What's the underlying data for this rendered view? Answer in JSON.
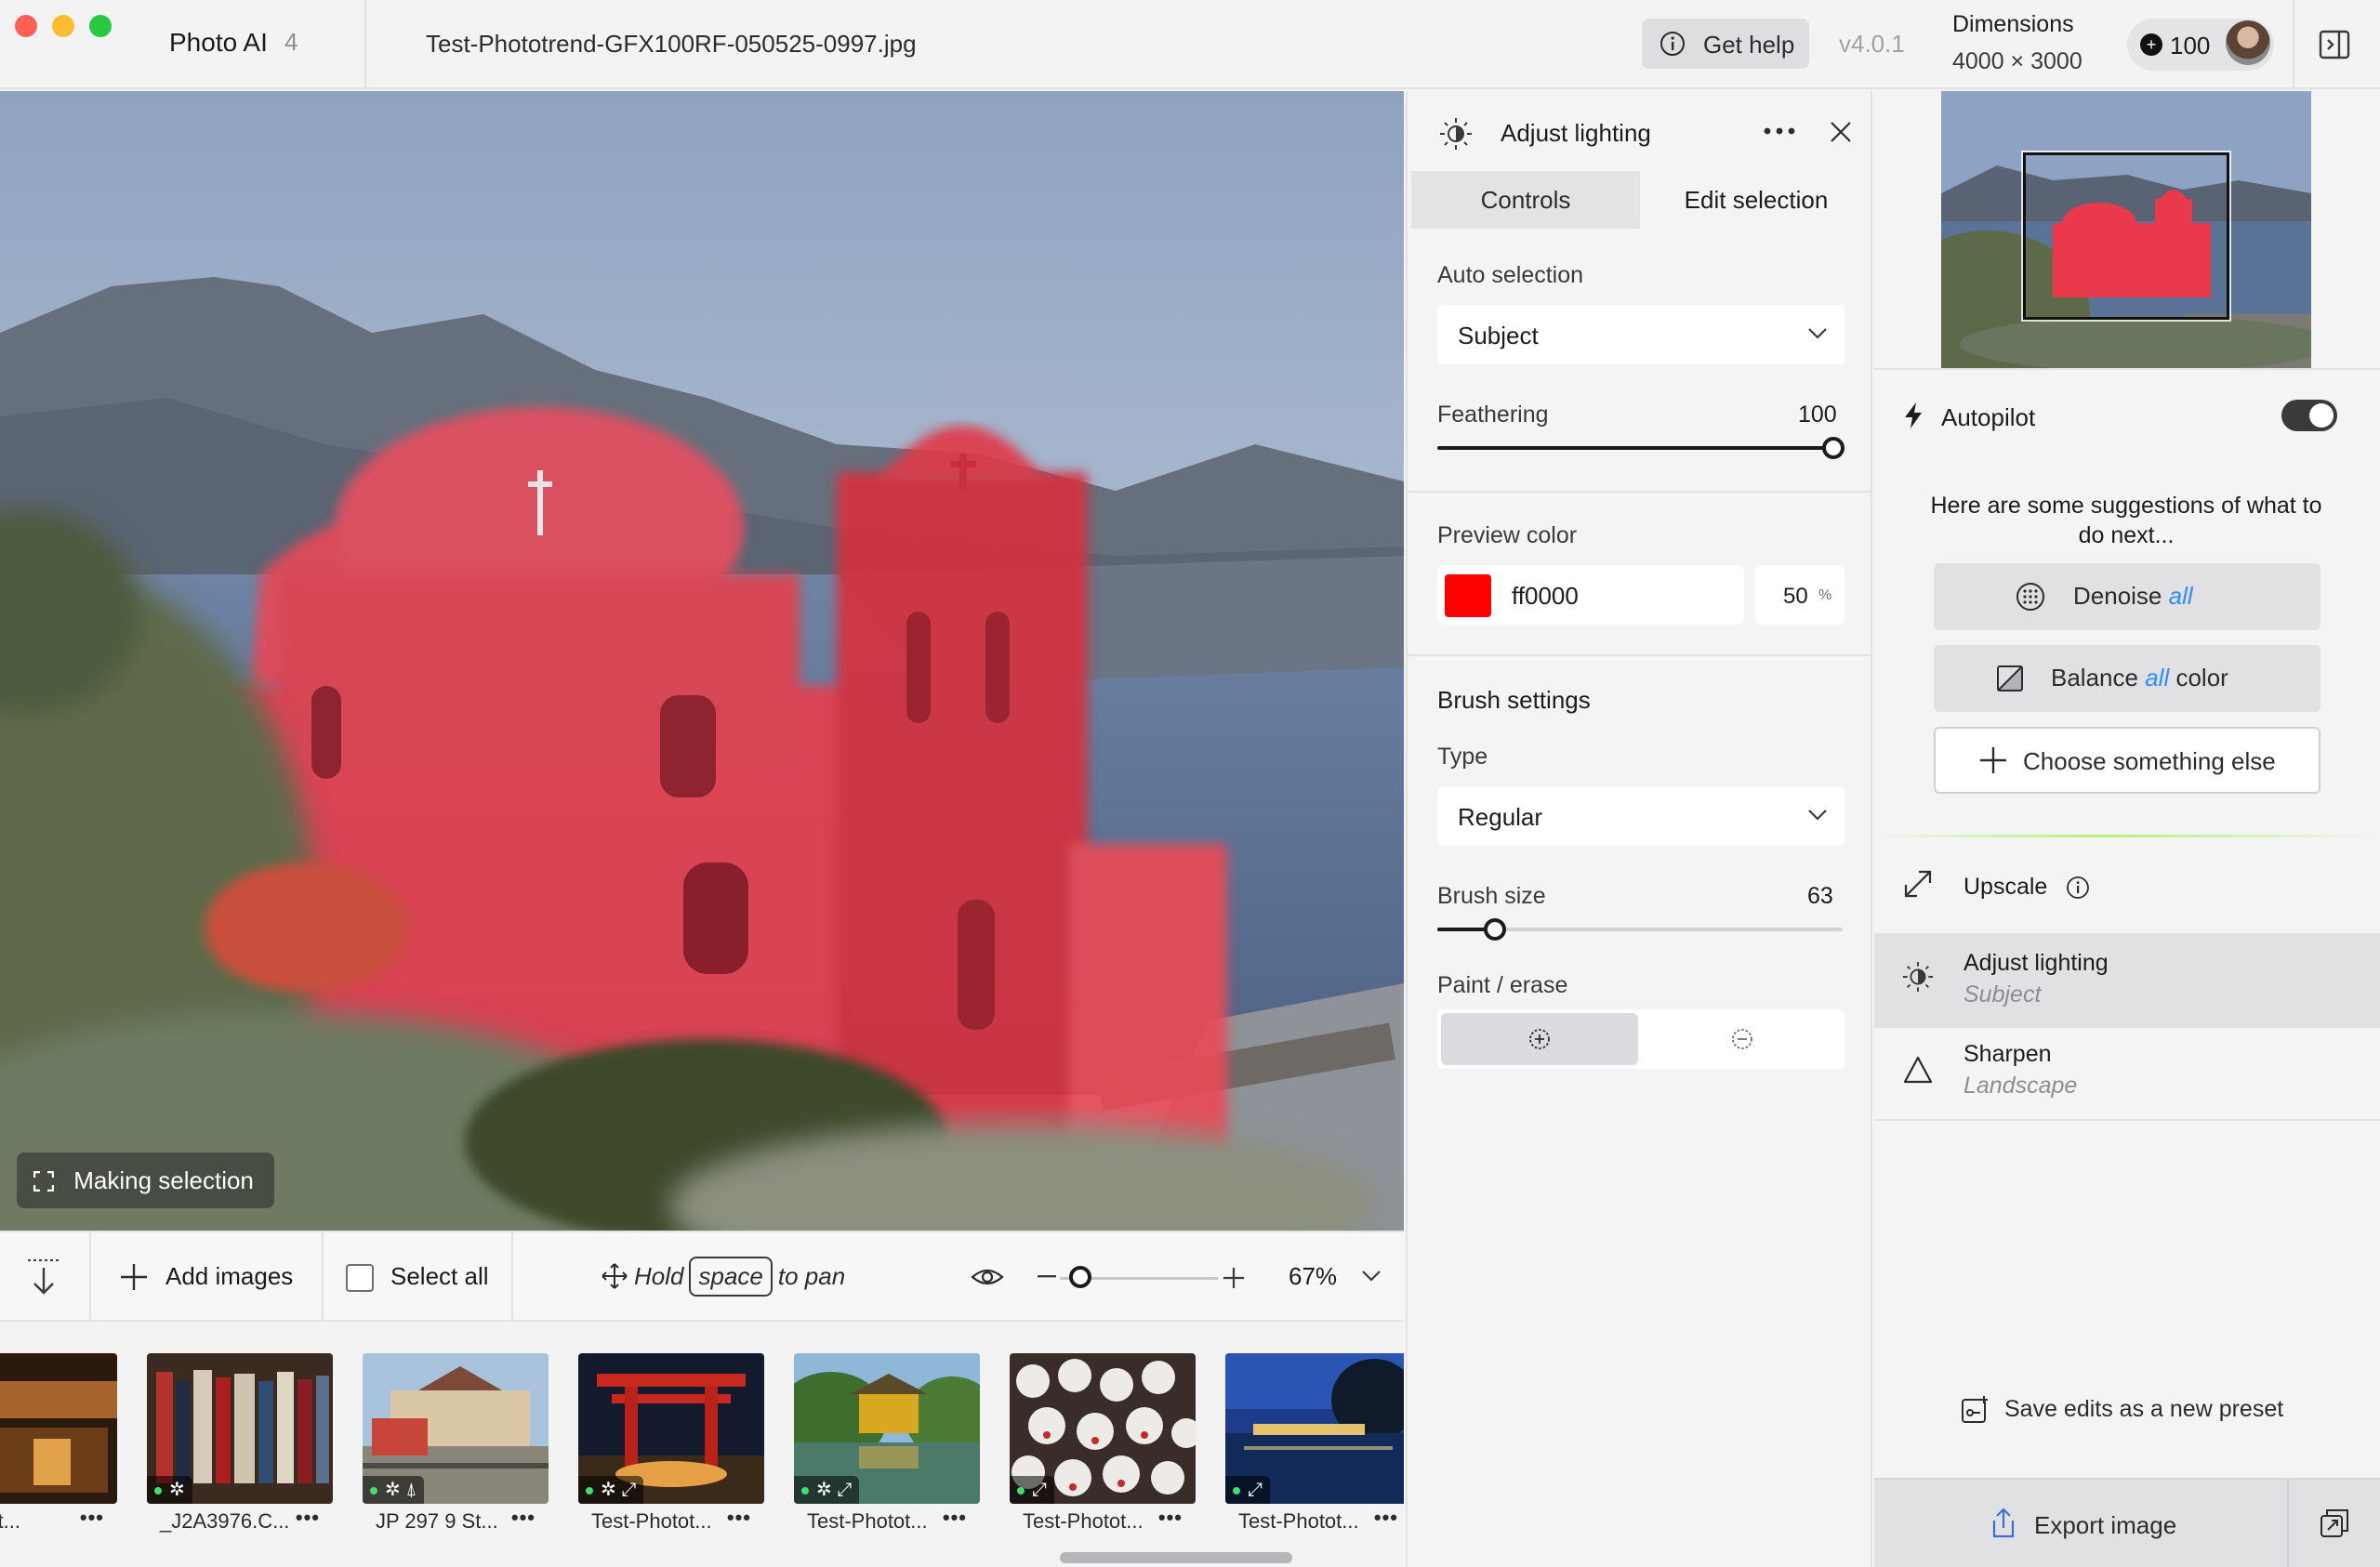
{
  "titlebar": {
    "app_name": "Photo AI",
    "app_version_badge": "4",
    "file_name": "Test-Phototrend-GFX100RF-050525-0997.jpg",
    "help_label": "Get help",
    "version": "v4.0.1",
    "dimensions_title": "Dimensions",
    "dimensions_value": "4000 × 3000",
    "credits": "100",
    "traffic_colors": [
      "#ff5f57",
      "#febc2e",
      "#28c840"
    ]
  },
  "canvas": {
    "status_label": "Making selection",
    "selection_color": "#ff0000"
  },
  "canvas_toolbar": {
    "add_images": "Add images",
    "select_all": "Select all",
    "pan_hold": "Hold",
    "pan_key": "space",
    "pan_suffix": "to pan",
    "zoom_value": "67%",
    "zoom_level": 0.67
  },
  "filmstrip": {
    "items": [
      {
        "label": "Photot...",
        "menu": "•••"
      },
      {
        "label": "_J2A3976.C...",
        "menu": "•••"
      },
      {
        "label": "JP 297 9 St...",
        "menu": "•••"
      },
      {
        "label": "Test-Photot...",
        "menu": "•••"
      },
      {
        "label": "Test-Photot...",
        "menu": "•••"
      },
      {
        "label": "Test-Photot...",
        "menu": "•••"
      },
      {
        "label": "Test-Photot...",
        "menu": "•••"
      }
    ]
  },
  "settings": {
    "title": "Adjust lighting",
    "tabs": [
      "Controls",
      "Edit selection"
    ],
    "active_tab": "Edit selection",
    "auto_selection_label": "Auto selection",
    "auto_selection_value": "Subject",
    "feathering_label": "Feathering",
    "feathering_value": "100",
    "preview_color_label": "Preview color",
    "preview_color_hex": "ff0000",
    "preview_opacity": "50",
    "preview_opacity_unit": "%",
    "brush_settings_heading": "Brush settings",
    "type_label": "Type",
    "type_value": "Regular",
    "brush_size_label": "Brush size",
    "brush_size_value": "63",
    "paint_erase_label": "Paint / erase"
  },
  "right_panel": {
    "autopilot_label": "Autopilot",
    "autopilot_on": true,
    "suggestion_text": "Here are some suggestions of what to do next...",
    "suggestions": [
      {
        "pre": "Denoise",
        "all": "all",
        "post": ""
      },
      {
        "pre": "Balance",
        "all": "all",
        "post": "color"
      }
    ],
    "choose_else": "Choose something else",
    "tools": [
      {
        "name": "Upscale",
        "sub": ""
      },
      {
        "name": "Adjust lighting",
        "sub": "Subject"
      },
      {
        "name": "Sharpen",
        "sub": "Landscape"
      }
    ],
    "save_preset": "Save edits as a new preset",
    "export": "Export image"
  },
  "icons": [
    "info-icon",
    "panel-toggle-icon",
    "lighting-icon",
    "more-icon",
    "close-icon",
    "chevron-down-icon",
    "paint-brush-icon",
    "erase-brush-icon",
    "autopilot-bolt-icon",
    "denoise-icon",
    "balance-icon",
    "plus-icon",
    "upscale-icon",
    "sharpen-icon",
    "preset-icon",
    "export-icon",
    "batch-export-icon",
    "eye-icon",
    "move-icon",
    "download-arrow-icon",
    "selection-corners-icon"
  ],
  "colors": {
    "accent_blue": "#2f8cff",
    "active_indicator": "#3ee06a"
  }
}
